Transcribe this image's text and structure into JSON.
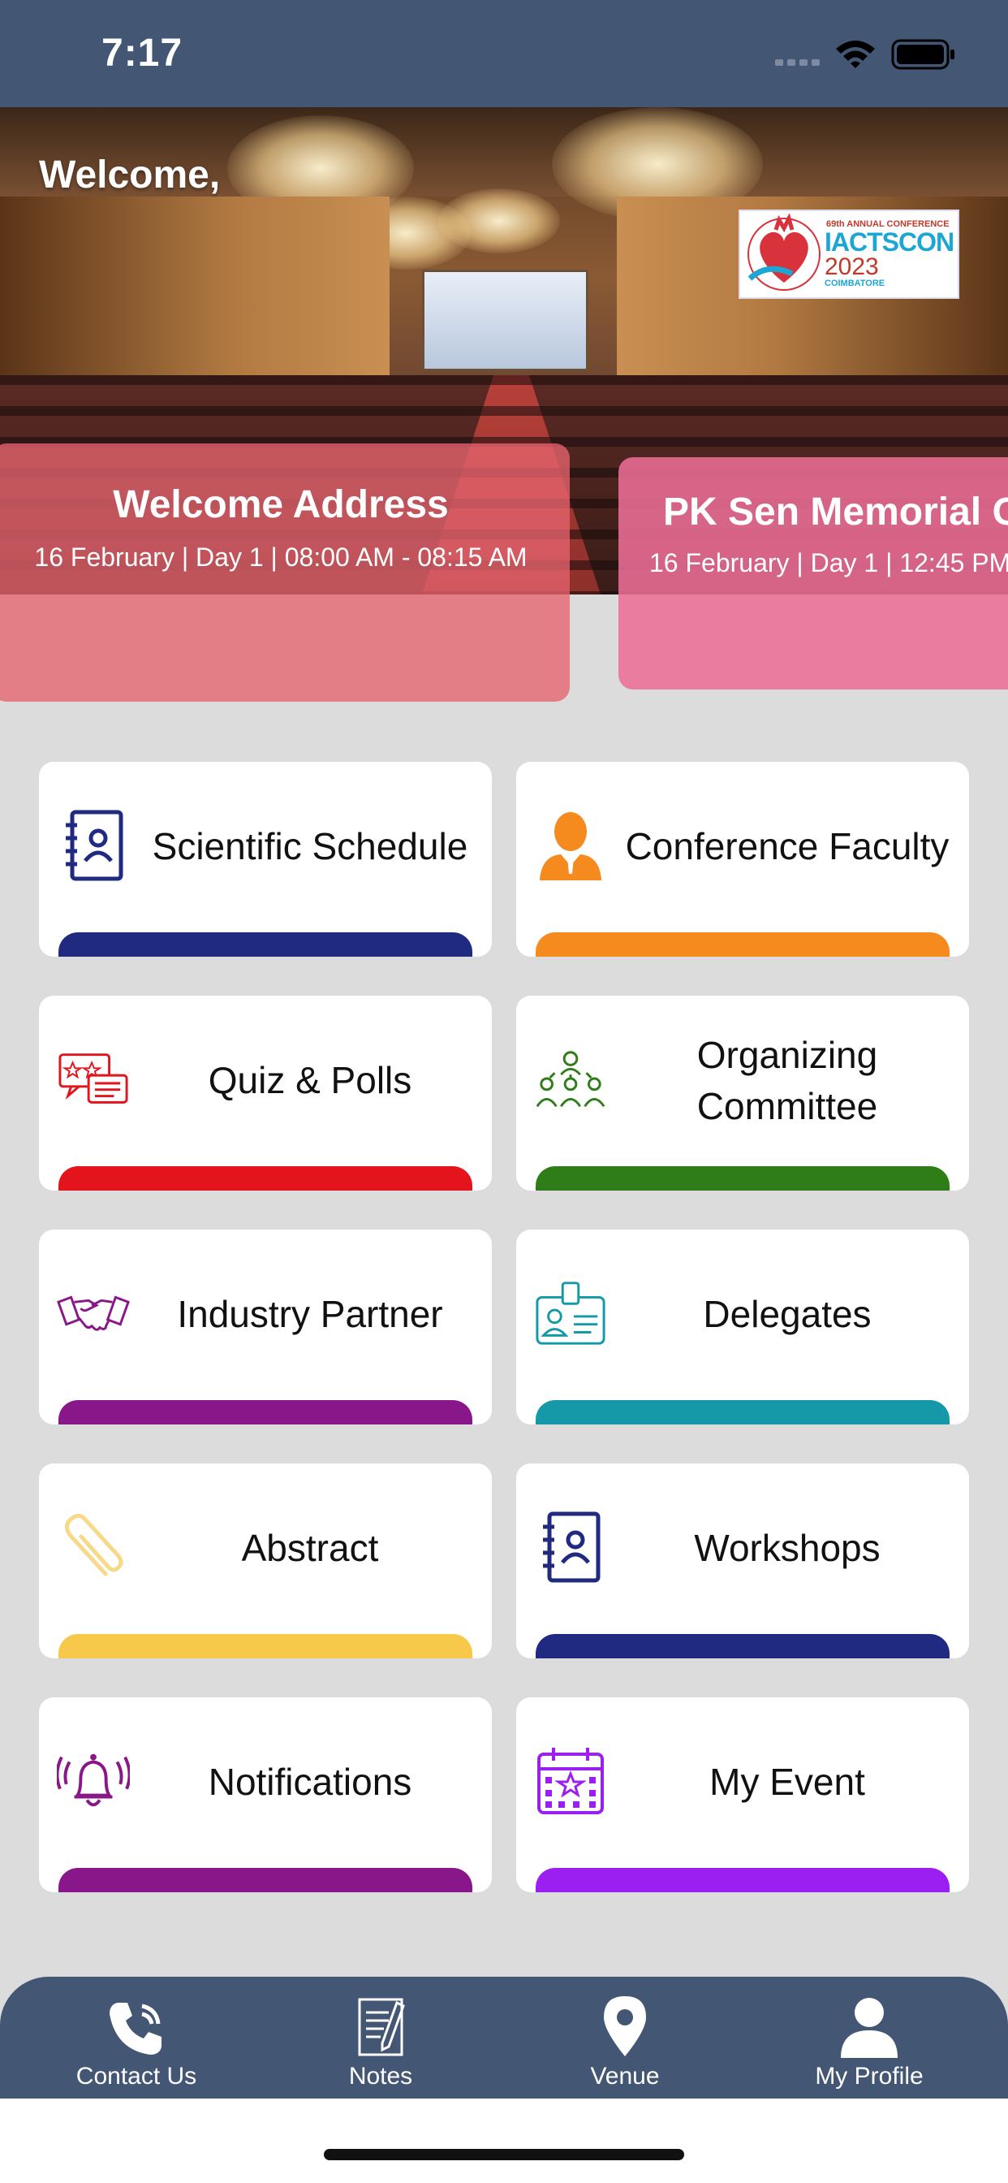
{
  "status_bar": {
    "time": "7:17"
  },
  "hero": {
    "welcome": "Welcome,",
    "logo": {
      "edition": "69th ANNUAL CONFERENCE",
      "name": "IACTSCON",
      "year": "2023",
      "city": "COIMBATORE"
    }
  },
  "events": [
    {
      "title": "Welcome Address",
      "time": "16 February | Day 1 | 08:00 AM - 08:15 AM",
      "color": "#e6646e"
    },
    {
      "title": "PK Sen Memorial O",
      "time": "16 February | Day 1 | 12:45 PM -",
      "color": "#ec6e96"
    }
  ],
  "tiles": [
    {
      "label": "Scientific Schedule",
      "icon": "address-book-icon",
      "color": "#1f2a80"
    },
    {
      "label": "Conference Faculty",
      "icon": "person-icon",
      "color": "#f58a1f"
    },
    {
      "label": "Quiz & Polls",
      "icon": "quiz-chat-icon",
      "color": "#e3141c"
    },
    {
      "label": "Organizing Committee",
      "icon": "committee-icon",
      "color": "#2f7d19"
    },
    {
      "label": "Industry Partner",
      "icon": "handshake-icon",
      "color": "#8a178a"
    },
    {
      "label": "Delegates",
      "icon": "id-badge-icon",
      "color": "#1598a8"
    },
    {
      "label": "Abstract",
      "icon": "paperclip-icon",
      "color": "#f7c94a"
    },
    {
      "label": "Workshops",
      "icon": "address-book-icon",
      "color": "#1f2a80"
    },
    {
      "label": "Notifications",
      "icon": "bell-icon",
      "color": "#8a178a"
    },
    {
      "label": "My Event",
      "icon": "calendar-icon",
      "color": "#9b1ff0"
    }
  ],
  "bottom_nav": [
    {
      "label": "Contact Us",
      "icon": "phone-icon"
    },
    {
      "label": "Notes",
      "icon": "notes-icon"
    },
    {
      "label": "Venue",
      "icon": "location-pin-icon"
    },
    {
      "label": "My Profile",
      "icon": "profile-icon"
    }
  ],
  "colors": {
    "header": "#435673",
    "background": "#dcdcdc"
  }
}
